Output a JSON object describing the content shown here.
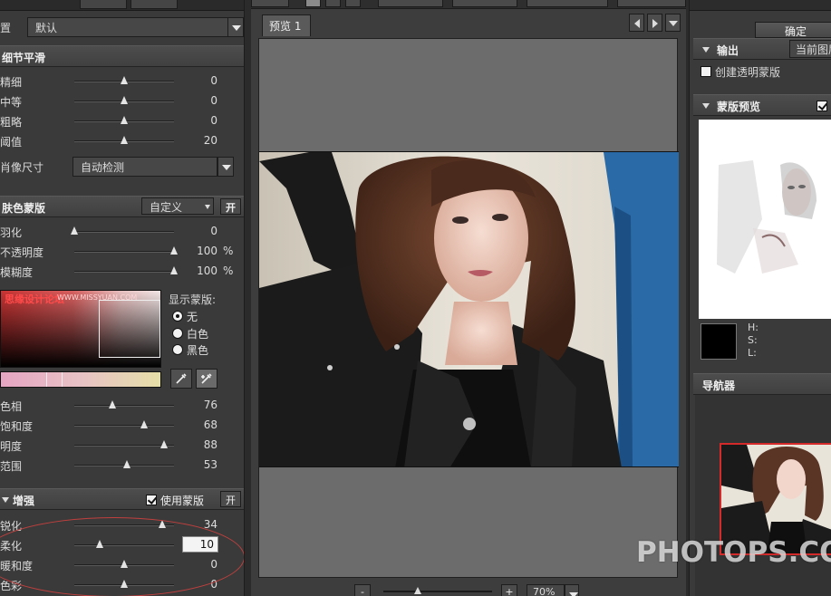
{
  "left": {
    "preset": {
      "label": "置",
      "value": "默认"
    },
    "detail_section": {
      "title": "细节平滑",
      "sliders": [
        {
          "label": "精细",
          "value": "0",
          "pos": 0.5
        },
        {
          "label": "中等",
          "value": "0",
          "pos": 0.5
        },
        {
          "label": "粗略",
          "value": "0",
          "pos": 0.5
        },
        {
          "label": "阈值",
          "value": "20",
          "pos": 0.5
        }
      ],
      "portrait_size": {
        "label": "肖像尺寸",
        "value": "自动检测"
      }
    },
    "skin_section": {
      "title": "肤色蒙版",
      "mode": "自定义",
      "toggle": "开",
      "sliders": [
        {
          "label": "羽化",
          "value": "0",
          "unit": "",
          "pos": 0.0
        },
        {
          "label": "不透明度",
          "value": "100",
          "unit": "%",
          "pos": 1.0
        },
        {
          "label": "模糊度",
          "value": "100",
          "unit": "%",
          "pos": 1.0
        }
      ],
      "watermark_cn": "思缘设计论坛",
      "watermark_url": "WWW.MISSYUAN.COM",
      "show_mask": {
        "label": "显示蒙版:",
        "options": [
          {
            "label": "无",
            "selected": true
          },
          {
            "label": "白色",
            "selected": false
          },
          {
            "label": "黑色",
            "selected": false
          }
        ]
      },
      "color_sliders": [
        {
          "label": "色相",
          "value": "76",
          "pos": 0.38
        },
        {
          "label": "饱和度",
          "value": "68",
          "pos": 0.7
        },
        {
          "label": "明度",
          "value": "88",
          "pos": 0.9
        },
        {
          "label": "范围",
          "value": "53",
          "pos": 0.53
        }
      ]
    },
    "enhance_section": {
      "title": "增强",
      "use_mask_label": "使用蒙版",
      "use_mask_checked": true,
      "toggle": "开",
      "sliders": [
        {
          "label": "锐化",
          "value": "34",
          "pos": 0.88
        },
        {
          "label": "柔化",
          "value": "10",
          "pos": 0.25,
          "editing": true
        },
        {
          "label": "暖和度",
          "value": "0",
          "pos": 0.5
        },
        {
          "label": "色彩",
          "value": "0",
          "pos": 0.5
        }
      ]
    }
  },
  "center": {
    "tab": "预览 1",
    "zoom": "70%",
    "zoom_minus": "-",
    "zoom_plus": "+"
  },
  "right": {
    "ok": "确定",
    "output": {
      "title": "输出",
      "value": "当前图层",
      "transparent_label": "创建透明蒙版"
    },
    "mask_preview": {
      "title": "蒙版预览",
      "checked": true
    },
    "hsl": {
      "h": "H:",
      "s": "S:",
      "l": "L:"
    },
    "navigator": {
      "title": "导航器"
    }
  },
  "watermark": "PHOTOPS.COM",
  "colors": {
    "panel": "#3a3a3a",
    "preview_bg": "#6c6c6c",
    "highlight": "#c0403e",
    "nav_frame": "#d42a2a"
  }
}
